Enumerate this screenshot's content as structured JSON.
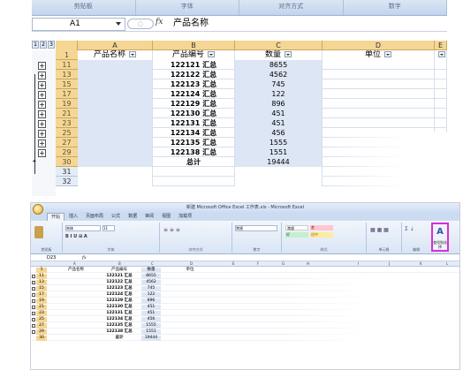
{
  "top": {
    "ribbon_groups": [
      "剪贴板",
      "字体",
      "对齐方式",
      "数字"
    ],
    "name_box": "A1",
    "formula_value": "产品名称",
    "level_buttons": [
      "1",
      "2",
      "3"
    ],
    "columns": [
      "A",
      "B",
      "C",
      "D",
      "E"
    ],
    "header_row": {
      "row": "1",
      "a": "产品名称",
      "b": "产品编号",
      "c": "数量",
      "d": "单位"
    },
    "rows": [
      {
        "row": "11",
        "b": "122121 汇总",
        "c": "8655"
      },
      {
        "row": "13",
        "b": "122122 汇总",
        "c": "4562"
      },
      {
        "row": "15",
        "b": "122123 汇总",
        "c": "745"
      },
      {
        "row": "17",
        "b": "122124 汇总",
        "c": "122"
      },
      {
        "row": "19",
        "b": "122129 汇总",
        "c": "896"
      },
      {
        "row": "21",
        "b": "122130 汇总",
        "c": "451"
      },
      {
        "row": "23",
        "b": "122131 汇总",
        "c": "451"
      },
      {
        "row": "25",
        "b": "122134 汇总",
        "c": "456"
      },
      {
        "row": "27",
        "b": "122135 汇总",
        "c": "1555"
      },
      {
        "row": "29",
        "b": "122138 汇总",
        "c": "1551"
      },
      {
        "row": "30",
        "b": "总计",
        "c": "19444"
      }
    ],
    "empty_rows": [
      "31",
      "32"
    ],
    "expand_symbol": "+",
    "collapse_symbol": "-"
  },
  "bottom": {
    "window_title": "新建 Microsoft Office Excel 工作表.xls - Microsoft Excel",
    "tabs": [
      "开始",
      "插入",
      "页面布局",
      "公式",
      "数据",
      "审阅",
      "视图",
      "加载项"
    ],
    "active_tab": "开始",
    "ribbon_groups": [
      "剪贴板",
      "字体",
      "对齐方式",
      "数字",
      "样式",
      "单元格",
      "编辑"
    ],
    "font_name": "宋体",
    "font_size": "11",
    "number_format": "常规",
    "styles": [
      "常规",
      "差",
      "好",
      "适中"
    ],
    "style_colors": [
      "#ffffff",
      "#ffc7ce",
      "#c6efce",
      "#ffeb9c"
    ],
    "find_select_label": "查找和选择",
    "find_select_glyph": "A",
    "highlight_color": "#d62ed6",
    "name_box": "D23",
    "fx": "fx",
    "columns": [
      "A",
      "B",
      "C",
      "D",
      "E",
      "F",
      "G",
      "H",
      "I",
      "J",
      "K",
      "L"
    ],
    "header_row": {
      "row": "1",
      "a": "产品名称",
      "b": "产品编号",
      "c": "数量",
      "d": "单位"
    },
    "rows": [
      {
        "row": "11",
        "b": "122121 汇总",
        "c": "8655"
      },
      {
        "row": "13",
        "b": "122122 汇总",
        "c": "4562"
      },
      {
        "row": "15",
        "b": "122123 汇总",
        "c": "745"
      },
      {
        "row": "17",
        "b": "122124 汇总",
        "c": "122"
      },
      {
        "row": "19",
        "b": "122129 汇总",
        "c": "896"
      },
      {
        "row": "21",
        "b": "122130 汇总",
        "c": "451"
      },
      {
        "row": "23",
        "b": "122131 汇总",
        "c": "451"
      },
      {
        "row": "25",
        "b": "122134 汇总",
        "c": "456"
      },
      {
        "row": "27",
        "b": "122135 汇总",
        "c": "1555"
      },
      {
        "row": "29",
        "b": "122138 汇总",
        "c": "1551"
      },
      {
        "row": "30",
        "b": "总计",
        "c": "19444"
      }
    ]
  }
}
